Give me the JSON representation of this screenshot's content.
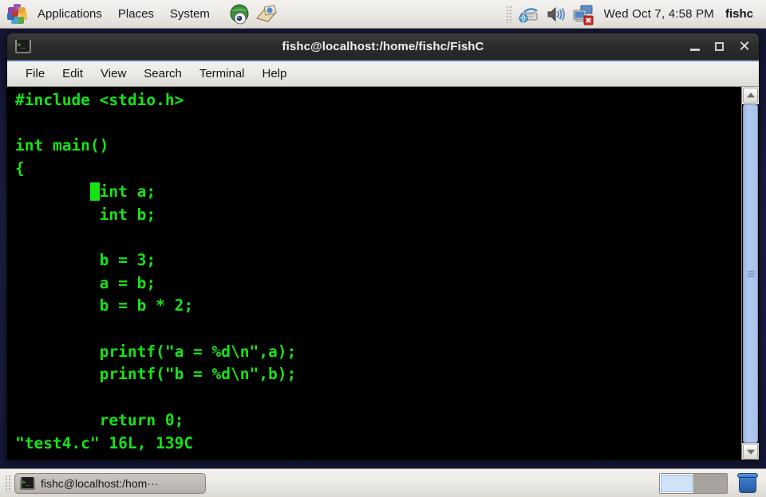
{
  "desktop": {
    "top_panel": {
      "logo_icon": "centos-logo-icon",
      "menus": [
        "Applications",
        "Places",
        "System"
      ],
      "launchers": [
        {
          "name": "web-browser-icon",
          "label": "Web Browser"
        },
        {
          "name": "email-client-icon",
          "label": "Email"
        }
      ],
      "tray": [
        {
          "name": "input-method-icon",
          "label": "Input Method"
        },
        {
          "name": "volume-icon",
          "label": "Volume"
        },
        {
          "name": "network-disconnected-icon",
          "label": "Network Disconnected"
        }
      ],
      "clock": "Wed Oct  7,  4:58 PM",
      "user": "fishc"
    },
    "bottom_panel": {
      "task": {
        "icon": "terminal-icon",
        "label": "fishc@localhost:/hom···"
      },
      "workspaces": [
        {
          "name": "workspace-1",
          "active": true
        },
        {
          "name": "workspace-2",
          "active": false
        }
      ],
      "trash_icon": "trash-icon"
    }
  },
  "window": {
    "title": "fishc@localhost:/home/fishc/FishC",
    "icon": "terminal-icon",
    "buttons": {
      "minimize": "minimize-button",
      "maximize": "maximize-button",
      "close": "close-button"
    },
    "menubar": [
      "File",
      "Edit",
      "View",
      "Search",
      "Terminal",
      "Help"
    ]
  },
  "terminal": {
    "foreground_color": "#16e416",
    "background_color": "#000000",
    "lines": [
      {
        "pre": "#include <stdio.h>",
        "cursor": "",
        "post": ""
      },
      {
        "pre": "",
        "cursor": "",
        "post": ""
      },
      {
        "pre": "int main()",
        "cursor": "",
        "post": ""
      },
      {
        "pre": "{",
        "cursor": "",
        "post": ""
      },
      {
        "pre": "        ",
        "cursor": "",
        "post": "int a;"
      },
      {
        "pre": "         ",
        "cursor": "",
        "post": "int b;"
      },
      {
        "pre": "",
        "cursor": "",
        "post": ""
      },
      {
        "pre": "         ",
        "cursor": "",
        "post": "b = 3;"
      },
      {
        "pre": "         ",
        "cursor": "",
        "post": "a = b;"
      },
      {
        "pre": "         ",
        "cursor": "",
        "post": "b = b * 2;"
      },
      {
        "pre": "",
        "cursor": "",
        "post": ""
      },
      {
        "pre": "         ",
        "cursor": "",
        "post": "printf(\"a = %d\\n\",a);"
      },
      {
        "pre": "         ",
        "cursor": "",
        "post": "printf(\"b = %d\\n\",b);"
      },
      {
        "pre": "",
        "cursor": "",
        "post": ""
      },
      {
        "pre": "         ",
        "cursor": "",
        "post": "return 0;"
      }
    ],
    "cursor_line_index": 4,
    "cursor_column": 8,
    "status_line": "\"test4.c\" 16L, 139C",
    "scrollbar": {
      "up_arrow": "scroll-up-arrow",
      "down_arrow": "scroll-down-arrow",
      "thumb": "scroll-thumb"
    }
  }
}
